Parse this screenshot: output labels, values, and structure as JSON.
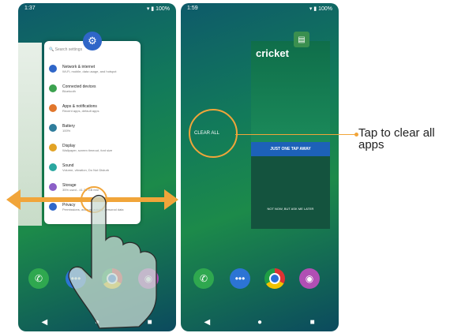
{
  "left_screen": {
    "status": {
      "time": "1:37",
      "battery": "100%"
    },
    "settings_card": {
      "search_placeholder": "Search settings",
      "items": [
        {
          "title": "Network & internet",
          "sub": "Wi-Fi, mobile, data usage, and hotspot",
          "color": "#2f66c8"
        },
        {
          "title": "Connected devices",
          "sub": "Bluetooth",
          "color": "#3ca24f"
        },
        {
          "title": "Apps & notifications",
          "sub": "Recent apps, default apps",
          "color": "#e1762c"
        },
        {
          "title": "Battery",
          "sub": "100%",
          "color": "#2f7d9c"
        },
        {
          "title": "Display",
          "sub": "Wallpaper, screen timeout, font size",
          "color": "#e2a325"
        },
        {
          "title": "Sound",
          "sub": "Volume, vibration, Do Not Disturb",
          "color": "#2aa7a0"
        },
        {
          "title": "Storage",
          "sub": "35% used - 41.33 GB free",
          "color": "#8b5fc7"
        },
        {
          "title": "Privacy",
          "sub": "Permissions, account activity, personal data",
          "color": "#2f66c8"
        }
      ]
    }
  },
  "right_screen": {
    "status": {
      "time": "1:59",
      "battery": "100%"
    },
    "clear_all_label": "CLEAR ALL",
    "cricket_card": {
      "logo": "cricket",
      "banner": "JUST ONE TAP AWAY",
      "footer": "NOT NOW, BUT ASK ME LATER"
    }
  },
  "dock_icons": [
    "phone-icon",
    "messages-icon",
    "chrome-icon",
    "camera-icon"
  ],
  "nav": [
    "back",
    "home",
    "recents"
  ],
  "callout_text": "Tap to clear all apps",
  "accent_color": "#f1a53a"
}
